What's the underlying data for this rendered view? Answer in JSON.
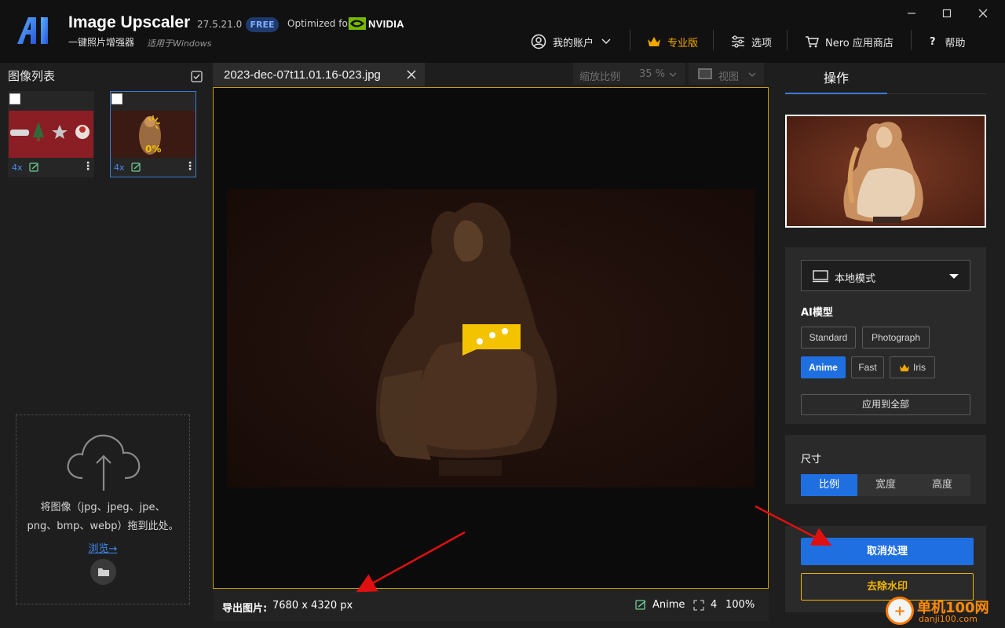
{
  "app": {
    "name": "Image Upscaler",
    "version": "27.5.21.0",
    "badge": "FREE",
    "optimized_for": "Optimized for",
    "nvidia": "NVIDIA",
    "tagline": "一键照片增强器",
    "tagline_sub": "适用于Windows"
  },
  "nav": {
    "account": "我的账户",
    "pro": "专业版",
    "options": "选项",
    "store": "Nero 应用商店",
    "help_mark": "?",
    "help": "帮助"
  },
  "left": {
    "title": "图像列表",
    "thumbs": [
      {
        "scale": "4x",
        "progress": ""
      },
      {
        "scale": "4x",
        "progress": "0%"
      }
    ],
    "drop_text_1": "将图像（jpg、jpeg、jpe、",
    "drop_text_2": "png、bmp、webp）拖到此处。",
    "browse": "浏览→"
  },
  "center": {
    "tab_name": "2023-dec-07t11.01.16-023.jpg",
    "zoom_label": "缩放比例",
    "zoom_value": "35 %",
    "view_label": "视图",
    "export_label": "导出图片:",
    "export_res": "7680 x 4320 px",
    "model": "Anime",
    "scale": "4",
    "quality": "100%"
  },
  "right": {
    "tab": "操作",
    "mode": "本地模式",
    "ai_title": "AI模型",
    "models": [
      "Standard",
      "Photograph",
      "Anime",
      "Fast",
      "Iris"
    ],
    "selected_model": "Anime",
    "apply_all": "应用到全部",
    "size_title": "尺寸",
    "size_tabs": [
      "比例",
      "宽度",
      "高度"
    ],
    "cancel": "取消处理",
    "watermark": "去除水印"
  },
  "site_watermark": {
    "name": "单机100网",
    "url": "danji100.com"
  },
  "colors": {
    "accent": "#1f6fe0",
    "gold": "#f0b400",
    "nvidia_green": "#76b900"
  }
}
